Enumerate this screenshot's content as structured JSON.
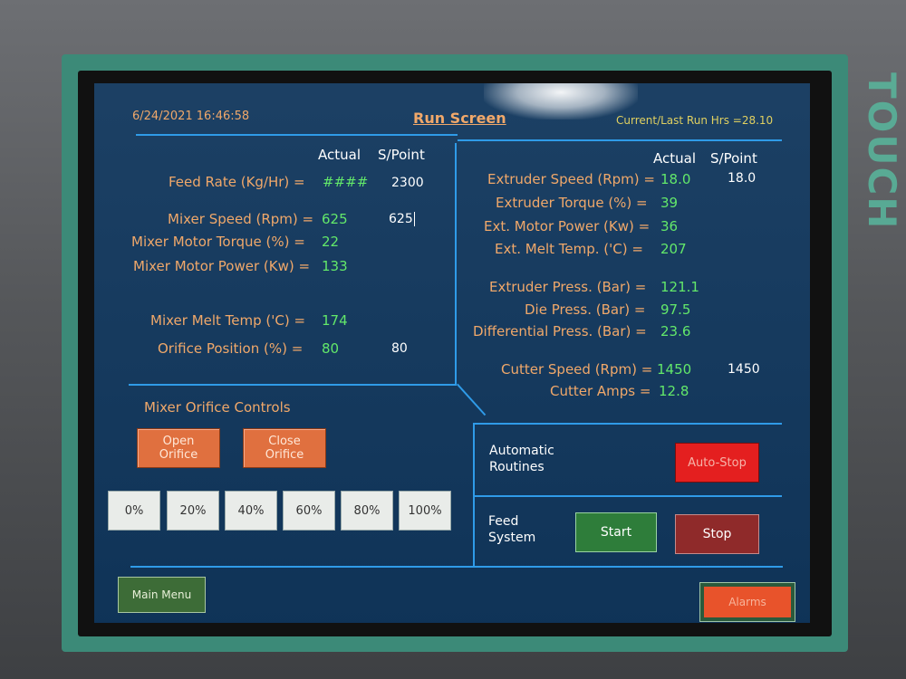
{
  "device": {
    "brand_text": "TOUCH"
  },
  "header": {
    "datetime": "6/24/2021 16:46:58",
    "title": "Run Screen",
    "run_hours_label": "Current/Last Run Hrs =",
    "run_hours_value": "28.10"
  },
  "left_panel": {
    "col_actual": "Actual",
    "col_setpoint": "S/Point",
    "rows": [
      {
        "label": "Feed Rate (Kg/Hr) =",
        "actual": "####",
        "setpoint": "2300"
      },
      {
        "label": "Mixer Speed (Rpm) =",
        "actual": "625",
        "setpoint": "625"
      },
      {
        "label": "Mixer Motor Torque (%) =",
        "actual": "22",
        "setpoint": ""
      },
      {
        "label": "Mixer Motor Power (Kw) =",
        "actual": "133",
        "setpoint": ""
      },
      {
        "label": "Mixer Melt Temp ('C) =",
        "actual": "174",
        "setpoint": ""
      },
      {
        "label": "Orifice Position (%) =",
        "actual": "80",
        "setpoint": "80"
      }
    ]
  },
  "right_panel": {
    "col_actual": "Actual",
    "col_setpoint": "S/Point",
    "rows": [
      {
        "label": "Extruder Speed (Rpm) =",
        "actual": "18.0",
        "setpoint": "18.0"
      },
      {
        "label": "Extruder Torque (%) =",
        "actual": "39",
        "setpoint": ""
      },
      {
        "label": "Ext. Motor Power (Kw) =",
        "actual": "36",
        "setpoint": ""
      },
      {
        "label": "Ext. Melt Temp. ('C) =",
        "actual": "207",
        "setpoint": ""
      },
      {
        "label": "Extruder Press. (Bar) =",
        "actual": "121.1",
        "setpoint": ""
      },
      {
        "label": "Die Press. (Bar) =",
        "actual": "97.5",
        "setpoint": ""
      },
      {
        "label": "Differential Press. (Bar) =",
        "actual": "23.6",
        "setpoint": ""
      },
      {
        "label": "Cutter Speed (Rpm) =",
        "actual": "1450",
        "setpoint": "1450"
      },
      {
        "label": "Cutter Amps =",
        "actual": "12.8",
        "setpoint": ""
      }
    ]
  },
  "orifice_controls": {
    "title": "Mixer Orifice Controls",
    "open_label": "Open\nOrifice",
    "close_label": "Close\nOrifice",
    "presets": [
      "0%",
      "20%",
      "40%",
      "60%",
      "80%",
      "100%"
    ]
  },
  "automatic": {
    "label": "Automatic\nRoutines",
    "auto_stop_label": "Auto-Stop"
  },
  "feed_system": {
    "label": "Feed\nSystem",
    "start_label": "Start",
    "stop_label": "Stop"
  },
  "footer": {
    "main_menu_label": "Main Menu",
    "alarms_label": "Alarms"
  },
  "colors": {
    "screen_bg": "#10365c",
    "divider": "#2f9be8",
    "label_orange": "#f0a86a",
    "value_green": "#63e86a",
    "start_green": "#2e7d3a",
    "stop_maroon": "#8f2a2a",
    "auto_stop_red": "#e41f1f",
    "orifice_orange": "#e0703f"
  }
}
